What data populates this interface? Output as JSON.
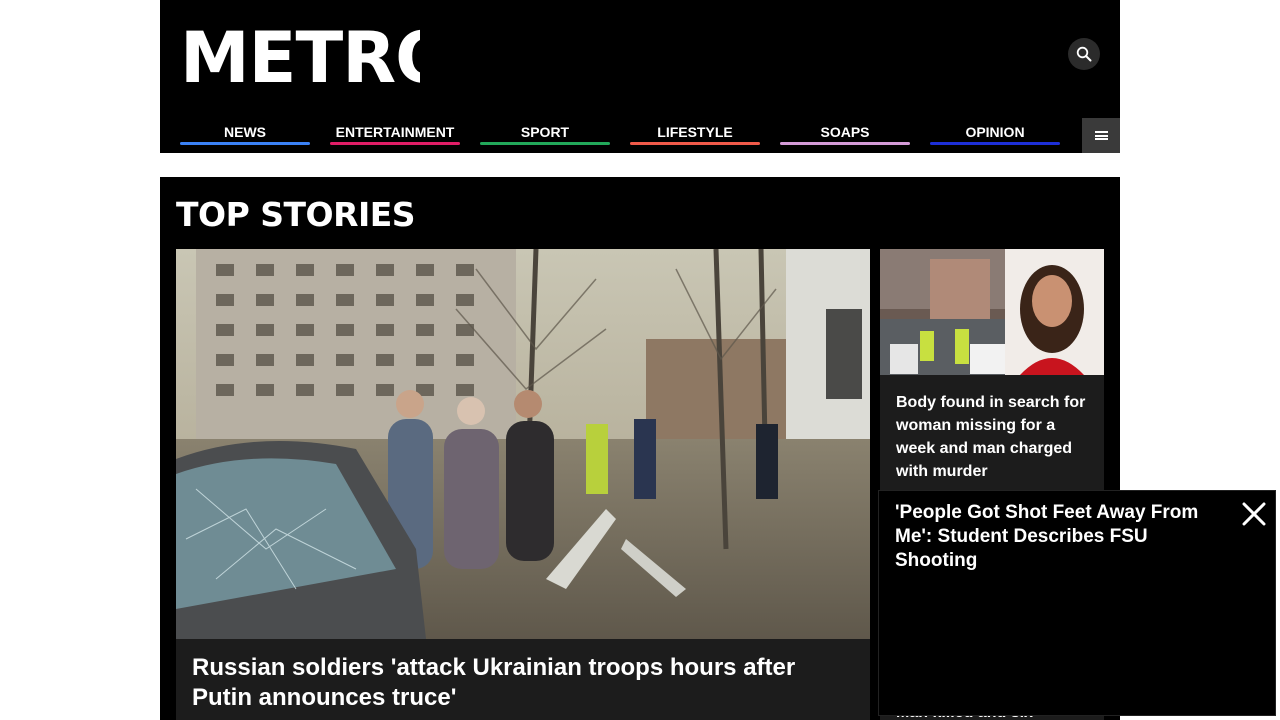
{
  "header": {
    "logo_text": "METRO",
    "search_icon": "search-icon",
    "menu_icon": "hamburger-menu-icon"
  },
  "nav": {
    "items": [
      {
        "label": "NEWS",
        "color": "#3b82f6"
      },
      {
        "label": "ENTERTAINMENT",
        "color": "#e11d67"
      },
      {
        "label": "SPORT",
        "color": "#22a85a"
      },
      {
        "label": "LIFESTYLE",
        "color": "#f05a4a"
      },
      {
        "label": "SOAPS",
        "color": "#d59bd8"
      },
      {
        "label": "OPINION",
        "color": "#1d2fd8"
      }
    ]
  },
  "top_stories": {
    "heading": "TOP STORIES",
    "lead": {
      "headline": "Russian soldiers 'attack Ukrainian troops hours after Putin announces truce'"
    },
    "side": [
      {
        "headline": "Body found in search for woman missing for a week and man charged with murder"
      },
      {
        "headline": "Man killed and six"
      }
    ]
  },
  "video_popup": {
    "title": "'People Got Shot Feet Away From Me': Student Describes FSU Shooting",
    "close_icon": "close-icon"
  }
}
